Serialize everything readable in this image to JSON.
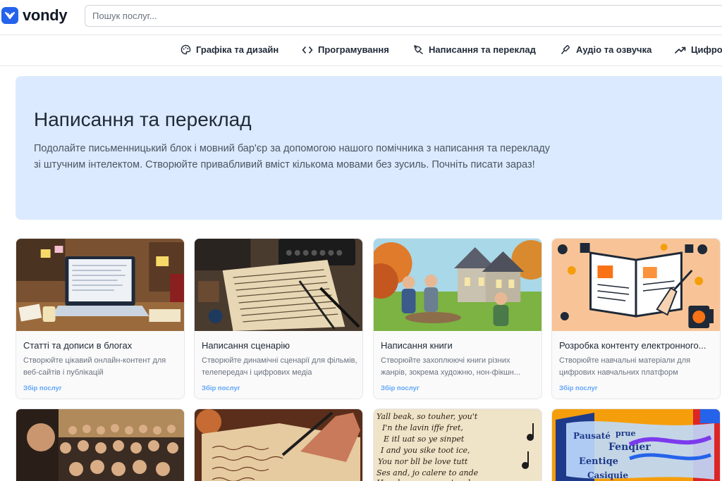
{
  "brand": {
    "name": "vondy"
  },
  "search": {
    "placeholder": "Пошук послуг..."
  },
  "categories": [
    {
      "label": "Графіка та дизайн",
      "icon": "palette-icon"
    },
    {
      "label": "Програмування",
      "icon": "code-icon"
    },
    {
      "label": "Написання та переклад",
      "icon": "pen-nib-icon"
    },
    {
      "label": "Аудіо та озвучка",
      "icon": "microphone-icon"
    },
    {
      "label": "Цифро",
      "icon": "trend-up-icon"
    }
  ],
  "hero": {
    "title": "Написання та переклад",
    "description": "Подолайте письменницький блок і мовний бар'єр за допомогою нашого помічника з написання та перекладу зі штучним інтелектом. Створюйте привабливий вміст кількома мовами без зусиль. Почніть писати зараз!"
  },
  "cards": [
    {
      "title": "Статті та дописи в блогах",
      "description": "Створюйте цікавий онлайн-контент для веб-сайтів і публікацій",
      "link": "Збір послуг"
    },
    {
      "title": "Написання сценарію",
      "description": "Створюйте динамічні сценарії для фільмів, телепередач і цифрових медіа",
      "link": "Збір послуг"
    },
    {
      "title": "Написання книги",
      "description": "Створюйте захоплюючі книги різних жанрів, зокрема художню, нон-фікшн...",
      "link": "Збір послуг"
    },
    {
      "title": "Розробка контенту електронного...",
      "description": "Створюйте навчальні матеріали для цифрових навчальних платформ",
      "link": "Збір послуг"
    }
  ],
  "colors": {
    "accent": "#2563eb",
    "hero_bg": "#dbeafe",
    "link": "#60a5fa"
  }
}
